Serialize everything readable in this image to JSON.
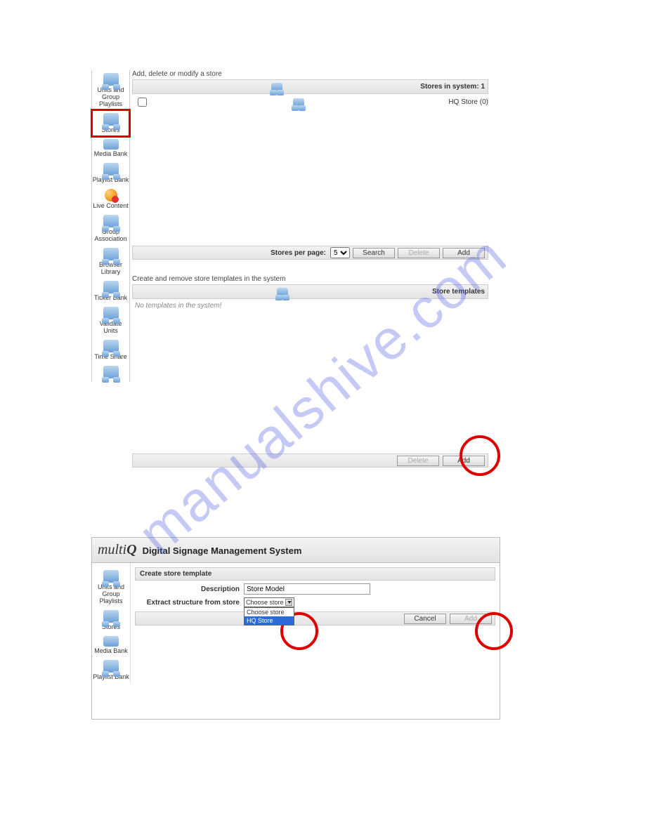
{
  "watermark": "manualshive.com",
  "shot1": {
    "sidebar": [
      {
        "label": "Units and Group Playlists",
        "icon": "units"
      },
      {
        "label": "Stores",
        "icon": "units",
        "active": true
      },
      {
        "label": "Media Bank",
        "icon": "single"
      },
      {
        "label": "Playlist Bank",
        "icon": "units"
      },
      {
        "label": "Live Content",
        "icon": "live"
      },
      {
        "label": "Group Association",
        "icon": "units"
      },
      {
        "label": "Browser Library",
        "icon": "units"
      },
      {
        "label": "Ticker Bank",
        "icon": "units"
      },
      {
        "label": "Validate Units",
        "icon": "units"
      },
      {
        "label": "Time Share",
        "icon": "units"
      }
    ],
    "caption_stores": "Add, delete or modify a store",
    "stores_header_pre": "Stores in system: ",
    "stores_count": "1",
    "tree_item": "HQ Store (0)",
    "pager_label": "Stores per page:",
    "pager_value": "5",
    "btn_search": "Search",
    "btn_delete": "Delete",
    "btn_add": "Add",
    "caption_templates": "Create and remove store templates in the system",
    "templates_header": "Store templates",
    "templates_empty": "No templates in the system!"
  },
  "shot2": {
    "brand_a": "multi",
    "brand_b": "Q",
    "title": "Digital Signage Management System",
    "sidebar": [
      {
        "label": "Units and Group Playlists",
        "icon": "units"
      },
      {
        "label": "Stores",
        "icon": "units"
      },
      {
        "label": "Media Bank",
        "icon": "single"
      },
      {
        "label": "Playlist Bank",
        "icon": "units"
      }
    ],
    "panel_title": "Create store template",
    "desc_label": "Description",
    "desc_value": "Store Model",
    "extract_label": "Extract structure from store",
    "dd_display": "Choose store",
    "dd_opts": [
      "Choose store",
      "HQ Store"
    ],
    "dd_selected_index": 1,
    "btn_cancel": "Cancel",
    "btn_add": "Add"
  }
}
